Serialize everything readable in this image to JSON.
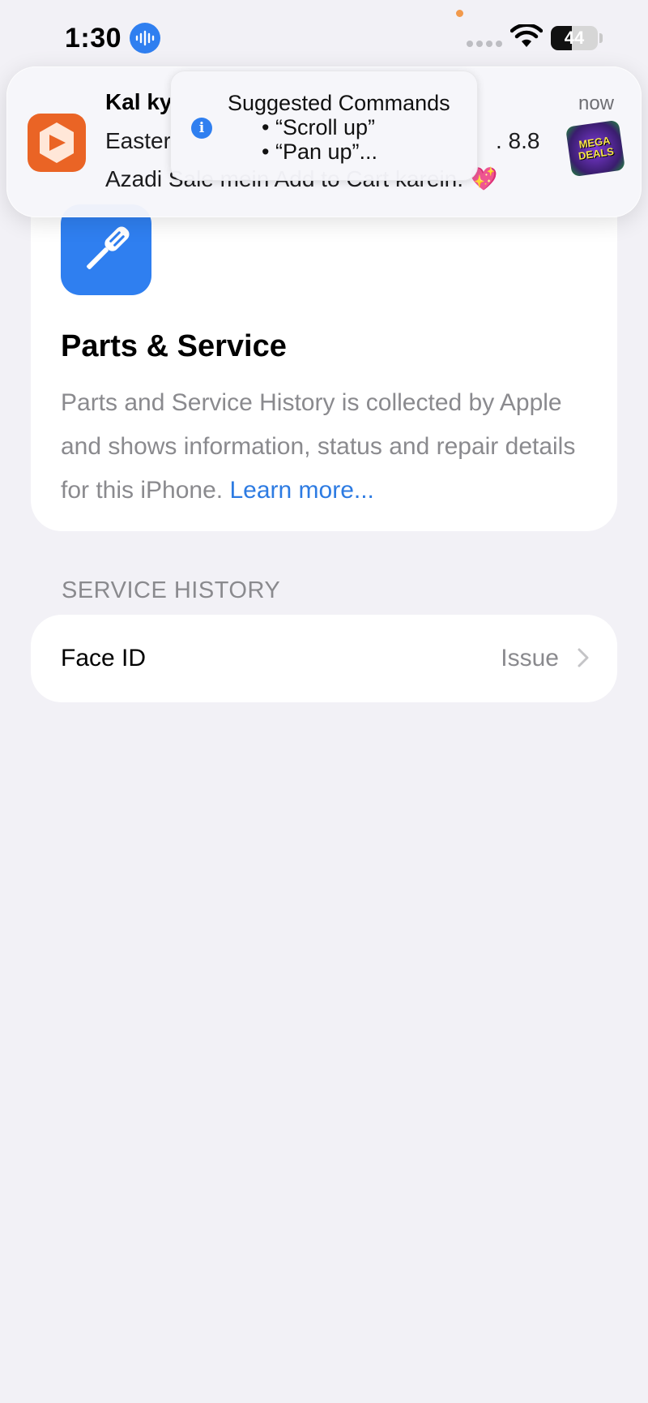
{
  "status_bar": {
    "time": "1:30",
    "battery_level": "44",
    "icons": [
      "voice-control-icon",
      "cellular-signal-icon",
      "wifi-icon",
      "battery-icon"
    ]
  },
  "notification": {
    "title": "Kal ky",
    "line1_start": "Easter",
    "line1_end": ". 8.8",
    "line2": "Azadi Sale mein Add to Cart karein. 💖",
    "time": "now",
    "thumbnail_text": [
      "MEGA",
      "DEALS"
    ],
    "accent_color": "#ea6425"
  },
  "suggested_commands": {
    "title": "Suggested Commands",
    "commands": [
      "• “Scroll up”",
      "• “Pan up”..."
    ]
  },
  "parts_service": {
    "title": "Parts & Service",
    "description": "Parts and Service History is collected by Apple and shows information, status and repair details for this iPhone.",
    "link_text": "Learn more...",
    "icon_color": "#2f7ff0"
  },
  "service_history": {
    "header": "SERVICE HISTORY",
    "rows": [
      {
        "label": "Face ID",
        "value": "Issue"
      }
    ]
  }
}
